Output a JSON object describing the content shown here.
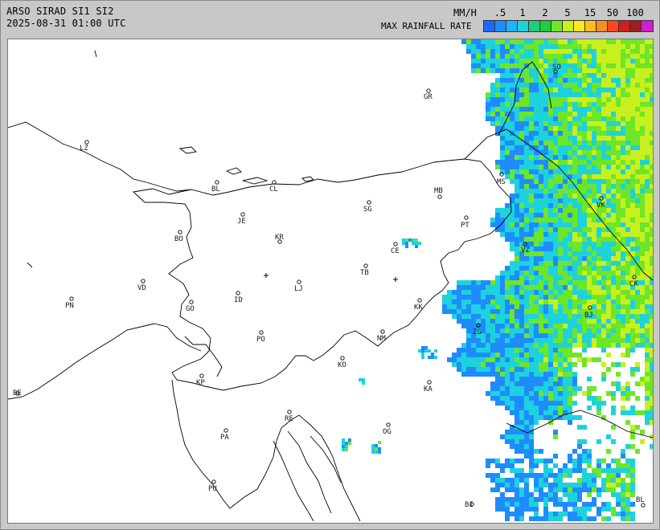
{
  "header": {
    "product": "ARSO SIRAD SI1 SI2",
    "timestamp": "2025-08-31 01:00 UTC"
  },
  "legend": {
    "unit": "MM/H",
    "label": "MAX RAINFALL RATE",
    "ticks": [
      ".5",
      "1",
      "2",
      "5",
      "15",
      "50",
      "100"
    ],
    "colors": [
      "#1d69ff",
      "#1e8cff",
      "#1eb4ff",
      "#1ed2dc",
      "#1ecc82",
      "#1ecc3c",
      "#6ee628",
      "#c8f01e",
      "#ffe61e",
      "#ffbe1e",
      "#ff8c1e",
      "#ff461e",
      "#d21e1e",
      "#a01e1e",
      "#d21ed2"
    ]
  },
  "radar_colors": {
    "light": "#1e8cff",
    "mid": "#1ed2dc",
    "heavy": "#6ee628",
    "strong": "#c8f01e"
  },
  "cities": [
    {
      "code": "GR"
    },
    {
      "code": "SO"
    },
    {
      "code": "LZ"
    },
    {
      "code": "BL"
    },
    {
      "code": "CL"
    },
    {
      "code": "MB"
    },
    {
      "code": "MS"
    },
    {
      "code": "VK"
    },
    {
      "code": "JE"
    },
    {
      "code": "SG"
    },
    {
      "code": "PT"
    },
    {
      "code": "BO"
    },
    {
      "code": "KR"
    },
    {
      "code": "CE"
    },
    {
      "code": "VZ"
    },
    {
      "code": "TB"
    },
    {
      "code": "VD"
    },
    {
      "code": "LJ"
    },
    {
      "code": "CK"
    },
    {
      "code": "PN"
    },
    {
      "code": "GO"
    },
    {
      "code": "ID"
    },
    {
      "code": "KK"
    },
    {
      "code": "BJ"
    },
    {
      "code": "ZG"
    },
    {
      "code": "PO"
    },
    {
      "code": "NM"
    },
    {
      "code": "KO"
    },
    {
      "code": "KP"
    },
    {
      "code": "KA"
    },
    {
      "code": "BE"
    },
    {
      "code": "RE"
    },
    {
      "code": "PA"
    },
    {
      "code": "OG"
    },
    {
      "code": "PU"
    },
    {
      "code": "BI"
    },
    {
      "code": "BL"
    }
  ]
}
